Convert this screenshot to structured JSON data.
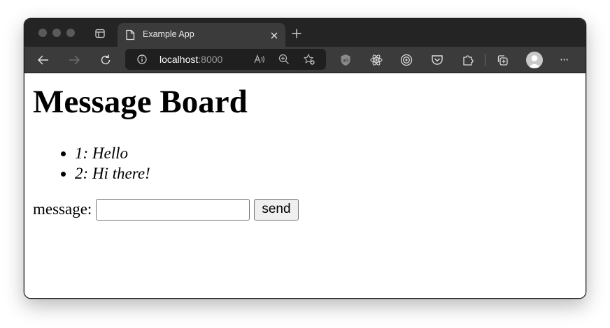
{
  "browser": {
    "tab": {
      "title": "Example App"
    },
    "address_bar": {
      "host": "localhost",
      "port": ":8000"
    },
    "menu_label": "···",
    "icons": {
      "tab_actions": "tab-actions-icon",
      "tab_page": "page-icon",
      "tab_close": "close-icon",
      "new_tab": "plus-icon",
      "back": "arrow-left-icon",
      "forward": "arrow-right-icon",
      "refresh": "refresh-icon",
      "site_info": "info-icon",
      "read_aloud": "read-aloud-icon",
      "zoom": "zoom-icon",
      "favorites": "favorite-star-icon",
      "extensions": [
        "ublock-origin-icon",
        "react-devtools-icon",
        "target-extension-icon",
        "pocket-icon",
        "puzzle-extensions-icon"
      ],
      "collections": "collections-icon",
      "profile": "profile-avatar-icon"
    }
  },
  "page": {
    "title": "Message Board",
    "messages": [
      {
        "text": "1: Hello"
      },
      {
        "text": "2: Hi there!"
      }
    ],
    "form": {
      "label": "message:",
      "input_value": "",
      "button_label": "send"
    }
  }
}
